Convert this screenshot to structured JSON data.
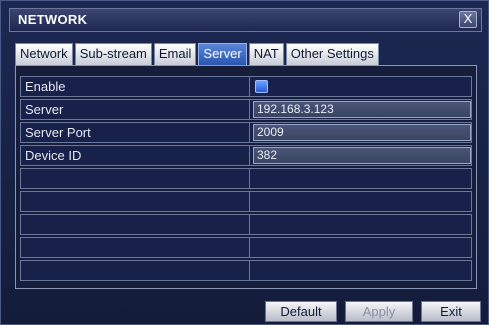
{
  "window": {
    "title": "NETWORK",
    "close_label": "X"
  },
  "tabs": [
    {
      "label": "Network",
      "active": false
    },
    {
      "label": "Sub-stream",
      "active": false
    },
    {
      "label": "Email",
      "active": false
    },
    {
      "label": "Server",
      "active": true
    },
    {
      "label": "NAT",
      "active": false
    },
    {
      "label": "Other Settings",
      "active": false
    }
  ],
  "form": {
    "rows": [
      {
        "label": "Enable",
        "type": "checkbox",
        "checked": true
      },
      {
        "label": "Server",
        "type": "text",
        "value": "192.168.3.123"
      },
      {
        "label": "Server Port",
        "type": "text",
        "value": "2009"
      },
      {
        "label": "Device ID",
        "type": "text",
        "value": "382"
      },
      {
        "label": "",
        "type": "empty"
      },
      {
        "label": "",
        "type": "empty"
      },
      {
        "label": "",
        "type": "empty"
      },
      {
        "label": "",
        "type": "empty"
      },
      {
        "label": "",
        "type": "empty"
      }
    ]
  },
  "buttons": {
    "default_label": "Default",
    "apply_label": "Apply",
    "exit_label": "Exit"
  },
  "colors": {
    "active_tab": "#2a56b0",
    "checkbox": "#2a5ad8",
    "background": "#161e3c"
  }
}
